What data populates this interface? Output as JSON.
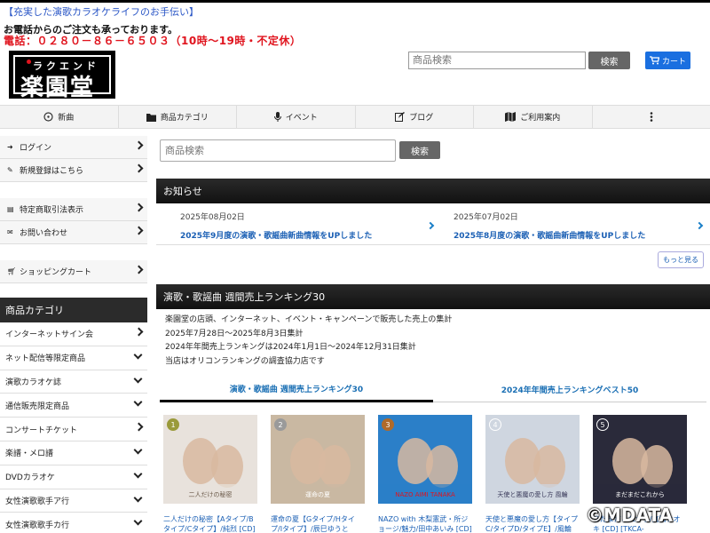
{
  "header": {
    "catchphrase": "【充実した演歌カラオケライフのお手伝い】",
    "phone_note": "お電話からのご注文も承っております。",
    "phone_line": "電話：０２８０－８６－６５０３（10時～19時・不定休）",
    "logo_kana": "ラクエンドウ",
    "logo_kanji": "楽園堂",
    "search_placeholder": "商品検索",
    "search_button": "検索",
    "cart_label": "カート"
  },
  "nav": {
    "items": [
      {
        "label": "新曲",
        "icon": "disc-icon"
      },
      {
        "label": "商品カテゴリ",
        "icon": "folder-icon"
      },
      {
        "label": "イベント",
        "icon": "microphone-icon"
      },
      {
        "label": "ブログ",
        "icon": "edit-icon"
      },
      {
        "label": "ご利用案内",
        "icon": "map-icon"
      },
      {
        "label": "",
        "icon": "more-vertical-icon"
      }
    ]
  },
  "sidebar": {
    "account": [
      {
        "label": "ログイン"
      },
      {
        "label": "新規登録はこちら"
      }
    ],
    "info": [
      {
        "label": "特定商取引法表示"
      },
      {
        "label": "お問い合わせ"
      }
    ],
    "cart": {
      "label": "ショッピングカート"
    },
    "category_head": "商品カテゴリ",
    "categories": [
      {
        "label": "インターネットサイン会",
        "chevron": "right"
      },
      {
        "label": "ネット配信等限定商品",
        "chevron": "down"
      },
      {
        "label": "演歌カラオケ誌",
        "chevron": "down"
      },
      {
        "label": "通信販売限定商品",
        "chevron": "down"
      },
      {
        "label": "コンサートチケット",
        "chevron": "right"
      },
      {
        "label": "楽譜・メロ譜",
        "chevron": "down"
      },
      {
        "label": "DVDカラオケ",
        "chevron": "down"
      },
      {
        "label": "女性演歌歌手ア行",
        "chevron": "down"
      },
      {
        "label": "女性演歌歌手カ行",
        "chevron": "down"
      }
    ]
  },
  "main": {
    "search_placeholder": "商品検索",
    "search_button": "検索",
    "news_head": "お知らせ",
    "news": [
      {
        "date": "2025年08月02日",
        "title": "2025年9月度の演歌・歌謡曲新曲情報をUPしました"
      },
      {
        "date": "2025年07月02日",
        "title": "2025年8月度の演歌・歌謡曲新曲情報をUPしました"
      }
    ],
    "more_label": "もっと見る",
    "ranking_head": "演歌・歌謡曲 週間売上ランキング30",
    "ranking_info": [
      "楽園堂の店頭、インターネット、イベント・キャンペーンで販売した売上の集計",
      "2025年7月28日～2025年8月3日集計",
      "2024年年間売上ランキングは2024年1月1日～2024年12月31日集計",
      "当店はオリコンランキングの調査協力店です"
    ],
    "tabs": [
      {
        "label": "演歌・歌謡曲 週間売上ランキング30",
        "active": true
      },
      {
        "label": "2024年年間売上ランキングベスト50",
        "active": false
      }
    ],
    "cards": [
      {
        "rank": "1",
        "title": "二人だけの秘密【Aタイプ/Bタイプ/Cタイプ】/純烈 [CD]",
        "cover_text": "二人だけの秘密",
        "badge_color": "#9a9a3a",
        "bg": "#e8e2dc",
        "fg": "#6b5a4a"
      },
      {
        "rank": "2",
        "title": "運命の夏【Gタイプ/Hタイプ/Iタイプ】/辰巳ゆうと [CD] [VICL-",
        "cover_text": "運命の夏",
        "badge_color": "#9a9a9a",
        "bg": "#c9b8a2",
        "fg": "#ffffff"
      },
      {
        "rank": "3",
        "title": "NAZO with 木梨憲武・所ジョージ/魅力/田中あいみ [CD]",
        "cover_text": "NAZO AIMI TANAKA",
        "badge_color": "#b06a2a",
        "bg": "#2b7fc8",
        "fg": "#e0141e"
      },
      {
        "rank": "4",
        "title": "天使と悪魔の愛し方【タイプC/タイプD/タイプE】/風輪 [CD]",
        "cover_text": "天使と悪魔の愛し方 風輪",
        "badge_color": "#ffffff",
        "bg": "#cfd6e0",
        "fg": "#3a3a5a"
      },
      {
        "rank": "5",
        "title": "まだまだこれから/真田ナオキ [CD] [TKCA-",
        "cover_text": "まだまだこれから",
        "badge_color": "#ffffff",
        "bg": "#2a2a3a",
        "fg": "#ffffff"
      }
    ]
  },
  "watermark": "©MDATA"
}
